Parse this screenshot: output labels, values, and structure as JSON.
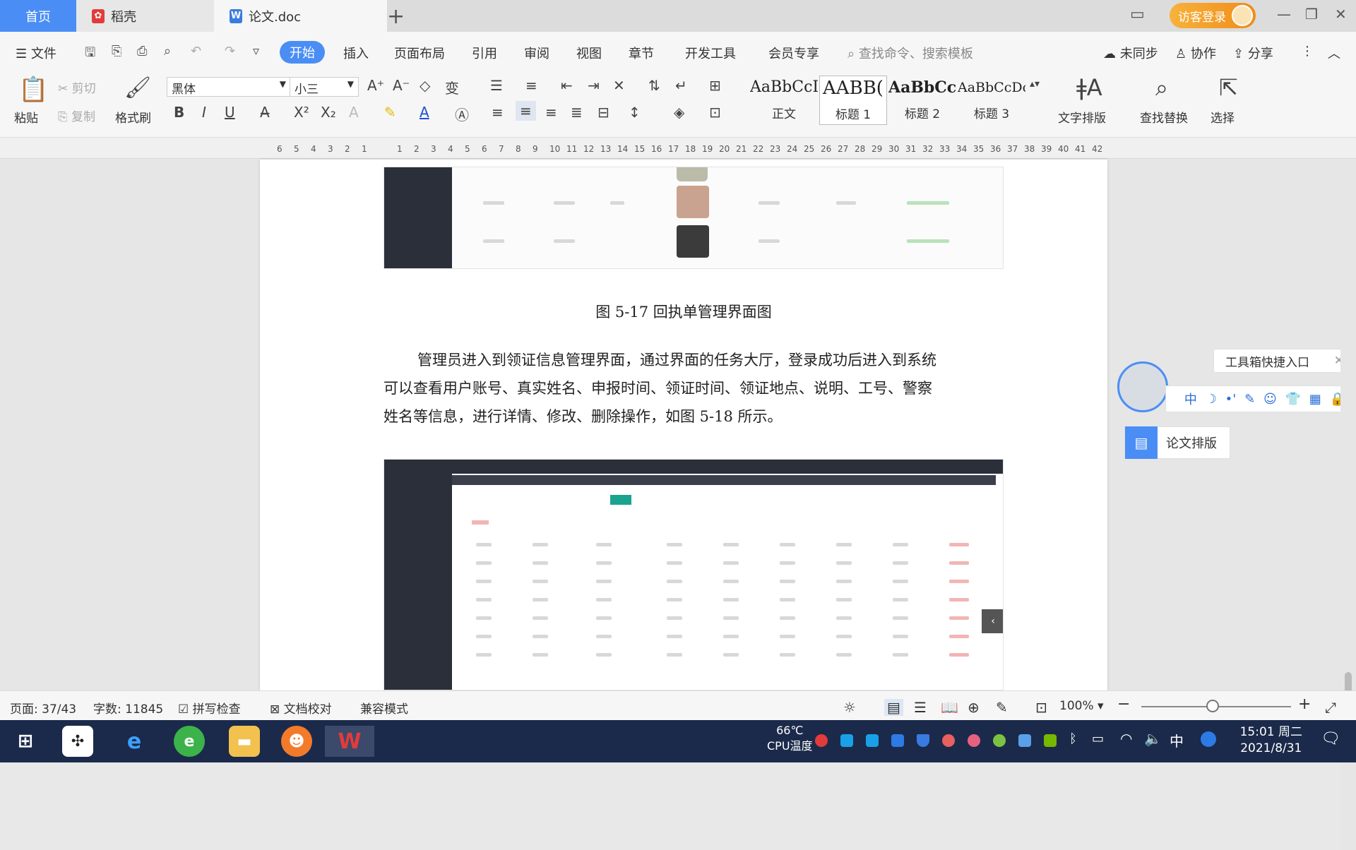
{
  "tabs": {
    "home": "首页",
    "docer": "稻壳",
    "doc": "论文.doc",
    "new_tab": "+"
  },
  "window": {
    "login": "访客登录"
  },
  "menu": {
    "file": "文件",
    "items": [
      "开始",
      "插入",
      "页面布局",
      "引用",
      "审阅",
      "视图",
      "章节",
      "开发工具",
      "会员专享"
    ],
    "search_placeholder": "查找命令、搜索模板",
    "sync": "未同步",
    "collab": "协作",
    "share": "分享"
  },
  "ribbon": {
    "paste": "粘贴",
    "cut": "剪切",
    "copy": "复制",
    "format_painter": "格式刷",
    "font_name": "黑体",
    "font_size": "小三",
    "styles": [
      {
        "preview": "AaBbCcI",
        "label": "正文"
      },
      {
        "preview": "AABB(",
        "label": "标题 1"
      },
      {
        "preview": "AaBbCc",
        "label": "标题 2"
      },
      {
        "preview": "AaBbCcDc",
        "label": "标题 3"
      }
    ],
    "text_layout": "文字排版",
    "find_replace": "查找替换",
    "select": "选择"
  },
  "ruler": {
    "left": [
      "6",
      "5",
      "4",
      "3",
      "2",
      "1"
    ],
    "right": [
      "1",
      "2",
      "3",
      "4",
      "5",
      "6",
      "7",
      "8",
      "9",
      "10",
      "11",
      "12",
      "13",
      "14",
      "15",
      "16",
      "17",
      "18",
      "19",
      "20",
      "21",
      "22",
      "23",
      "24",
      "25",
      "26",
      "27",
      "28",
      "29",
      "30",
      "31",
      "32",
      "33",
      "34",
      "35",
      "36",
      "37",
      "38",
      "39",
      "40",
      "41",
      "42"
    ]
  },
  "document": {
    "caption": "图 5-17 回执单管理界面图",
    "paragraph_lines": [
      "管理员进入到领证信息管理界面，通过界面的任务大厅，登录成功后进入到系统",
      "可以查看用户账号、真实姓名、申报时间、领证时间、领证地点、说明、工号、警察",
      "姓名等信息，进行详情、修改、删除操作，如图 5-18 所示。"
    ]
  },
  "side_panel": {
    "toolbox": "工具箱快捷入口",
    "toolbox_icons": [
      "中",
      "☽",
      "•'",
      "✎",
      "☺",
      "👕",
      "▦",
      "🔒"
    ],
    "paper_layout": "论文排版"
  },
  "status": {
    "page": "页面: 37/43",
    "words": "字数: 11845",
    "spell": "拼写检查",
    "proof": "文档校对",
    "compat": "兼容模式",
    "zoom": "100%"
  },
  "taskbar": {
    "temp": "66℃",
    "temp_label": "CPU温度",
    "ime": "中",
    "time": "15:01 周二",
    "date": "2021/8/31"
  },
  "colors": {
    "accent": "#4a8ef5",
    "login": "#f39a20",
    "taskbar": "#1b2a4a"
  }
}
